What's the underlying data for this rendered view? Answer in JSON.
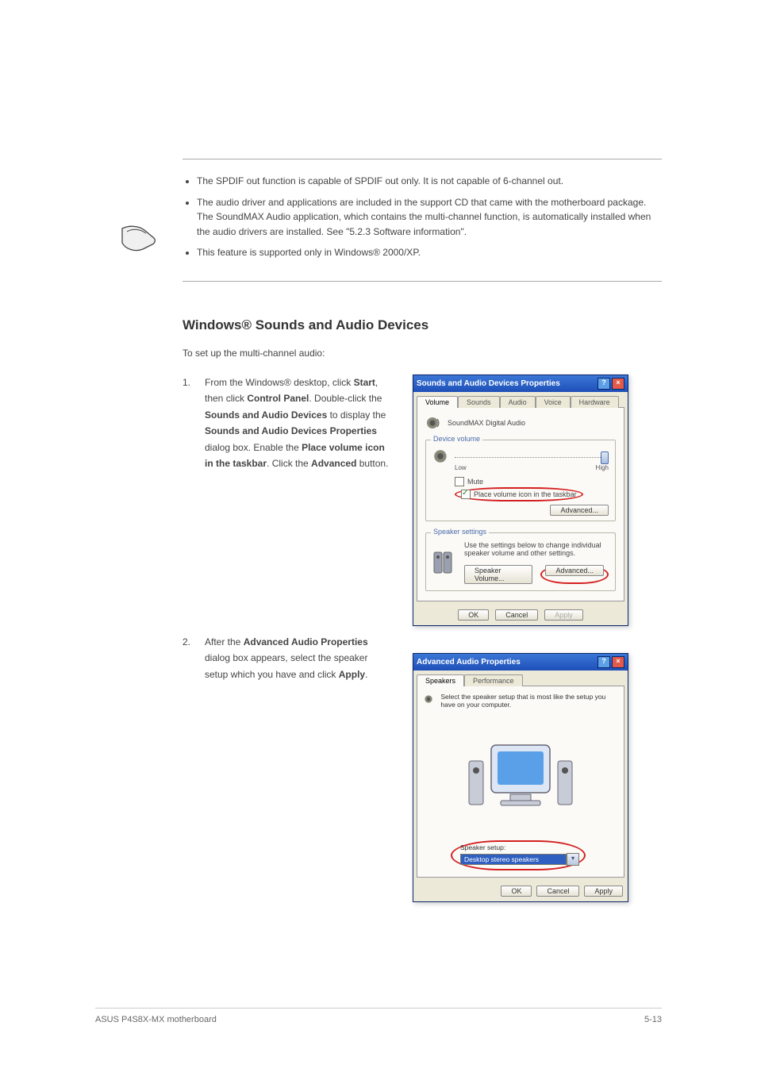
{
  "notes": {
    "items": [
      "The SPDIF out function is capable of SPDIF out only. It is not capable of 6-channel out.",
      "The audio driver and applications are included in the support CD that came with the motherboard package. The SoundMAX Audio application, which contains the multi-channel function, is automatically installed when the audio drivers are installed. See \"5.2.3 Software information\".",
      "This feature is supported only in Windows® 2000/XP."
    ]
  },
  "heading": "Windows® Sounds and Audio Devices",
  "instruction": "To set up the multi-channel audio:",
  "step1": {
    "num": "1.",
    "pre": "From the Windows® desktop, click ",
    "b1": "Start",
    "mid1": ", then click ",
    "b2": "Control Panel",
    "mid2": ". Double-click the ",
    "b3": "Sounds and Audio Devices",
    "mid3": " to display the ",
    "b4": "Sounds and Audio Devices Properties ",
    "post": "dialog box. Enable the ",
    "b5": "Place volume icon in the taskbar",
    "mid4": ". Click the ",
    "b6": "Advanced",
    "end": " button."
  },
  "step2": {
    "num": "2.",
    "pre": "After the ",
    "b1": "Advanced Audio Properties",
    "mid1": " dialog box appears, select the speaker setup which you have and click ",
    "b2": "Apply",
    "end": "."
  },
  "dlg1": {
    "title": "Sounds and Audio Devices Properties",
    "tabs": [
      "Volume",
      "Sounds",
      "Audio",
      "Voice",
      "Hardware"
    ],
    "device": "SoundMAX Digital Audio",
    "group_device": "Device volume",
    "low": "Low",
    "high": "High",
    "mute": "Mute",
    "place_icon": "Place volume icon in the taskbar",
    "advanced": "Advanced...",
    "group_speaker": "Speaker settings",
    "speaker_desc": "Use the settings below to change individual speaker volume and other settings.",
    "speaker_vol": "Speaker Volume...",
    "ok": "OK",
    "cancel": "Cancel",
    "apply": "Apply"
  },
  "dlg2": {
    "title": "Advanced Audio Properties",
    "tabs": [
      "Speakers",
      "Performance"
    ],
    "desc": "Select the speaker setup that is most like the setup you have on your computer.",
    "setup_label": "Speaker setup:",
    "combo": "Desktop stereo speakers",
    "ok": "OK",
    "cancel": "Cancel",
    "apply": "Apply"
  },
  "footer": {
    "left": "ASUS P4S8X-MX motherboard",
    "right": "5-13"
  }
}
